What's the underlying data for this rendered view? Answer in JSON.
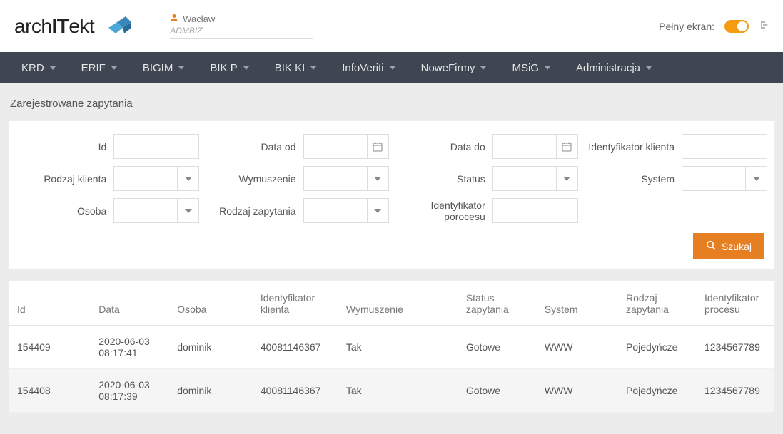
{
  "header": {
    "logo_prefix": "arch",
    "logo_mid": "IT",
    "logo_suffix": "ekt",
    "user_name": "Wacław",
    "user_role": "ADMBIZ",
    "fullscreen_label": "Pełny ekran:"
  },
  "nav": {
    "items": [
      "KRD",
      "ERIF",
      "BIGIM",
      "BIK P",
      "BIK KI",
      "InfoVeriti",
      "NoweFirmy",
      "MSiG",
      "Administracja"
    ]
  },
  "page": {
    "title": "Zarejestrowane zapytania"
  },
  "filters": {
    "row1": {
      "id_label": "Id",
      "data_od_label": "Data od",
      "data_do_label": "Data do",
      "ident_klienta_label": "Identyfikator klienta"
    },
    "row2": {
      "rodzaj_klienta_label": "Rodzaj klienta",
      "wymuszenie_label": "Wymuszenie",
      "status_label": "Status",
      "system_label": "System"
    },
    "row3": {
      "osoba_label": "Osoba",
      "rodzaj_zapytania_label": "Rodzaj zapytania",
      "ident_procesu_label": "Identyfikator porocesu"
    },
    "search_label": "Szukaj"
  },
  "table": {
    "headers": {
      "id": "Id",
      "data": "Data",
      "osoba": "Osoba",
      "ident_klienta": "Identyfikator klienta",
      "wymuszenie": "Wymuszenie",
      "status": "Status zapytania",
      "system": "System",
      "rodzaj": "Rodzaj zapytania",
      "ident_procesu": "Identyfikator procesu"
    },
    "rows": [
      {
        "id": "154409",
        "data": "2020-06-03 08:17:41",
        "osoba": "dominik",
        "ident_klienta": "40081146367",
        "wymuszenie": "Tak",
        "status": "Gotowe",
        "system": "WWW",
        "rodzaj": "Pojedyńcze",
        "ident_procesu": "1234567789"
      },
      {
        "id": "154408",
        "data": "2020-06-03 08:17:39",
        "osoba": "dominik",
        "ident_klienta": "40081146367",
        "wymuszenie": "Tak",
        "status": "Gotowe",
        "system": "WWW",
        "rodzaj": "Pojedyńcze",
        "ident_procesu": "1234567789"
      }
    ]
  }
}
